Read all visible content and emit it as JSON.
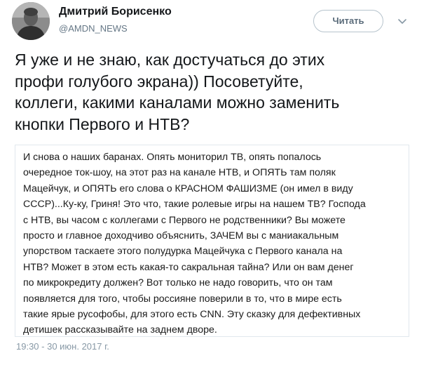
{
  "author": {
    "name": "Дмитрий Борисенко",
    "handle": "@AMDN_NEWS",
    "avatar_icon": "avatar-photo"
  },
  "follow_button": {
    "label": "Читать"
  },
  "menu": {
    "icon": "chevron-down-icon"
  },
  "tweet": {
    "lines": [
      "Я уже и не знаю, как достучаться до этих",
      "профи голубого экрана)) Посоветуйте,",
      "коллеги, какими каналами можно заменить",
      "кнопки Первого и НТВ?"
    ]
  },
  "attachment": {
    "lines": [
      "И снова о наших баранах. Опять мониторил ТВ, опять попалось",
      "очередное ток-шоу, на этот раз на канале НТВ, и ОПЯТЬ там поляк",
      "Мацейчук, и ОПЯТЬ его слова о КРАСНОМ ФАШИЗМЕ (он имел в виду",
      "СССР)...Ку-ку, Гриня! Это что, такие ролевые игры на нашем ТВ? Господа",
      "с НТВ, вы часом с коллегами с Первого не родственники? Вы можете",
      "просто и главное доходчиво объяснить, ЗАЧЕМ вы с маниакальным",
      "упорством таскаете этого полудурка Мацейчука с Первого канала на",
      "НТВ? Может в этом есть какая-то сакральная тайна? Или он вам денег",
      "по микрокредиту должен? Вот только не надо говорить, что он там",
      "появляется для того, чтобы россияне поверили в то, что в мире есть",
      "такие ярые русофобы, для этого есть CNN. Эту сказку для дефективных",
      "детишек рассказывайте на заднем дворе."
    ]
  },
  "timestamp": "19:30 - 30 июн. 2017 г."
}
